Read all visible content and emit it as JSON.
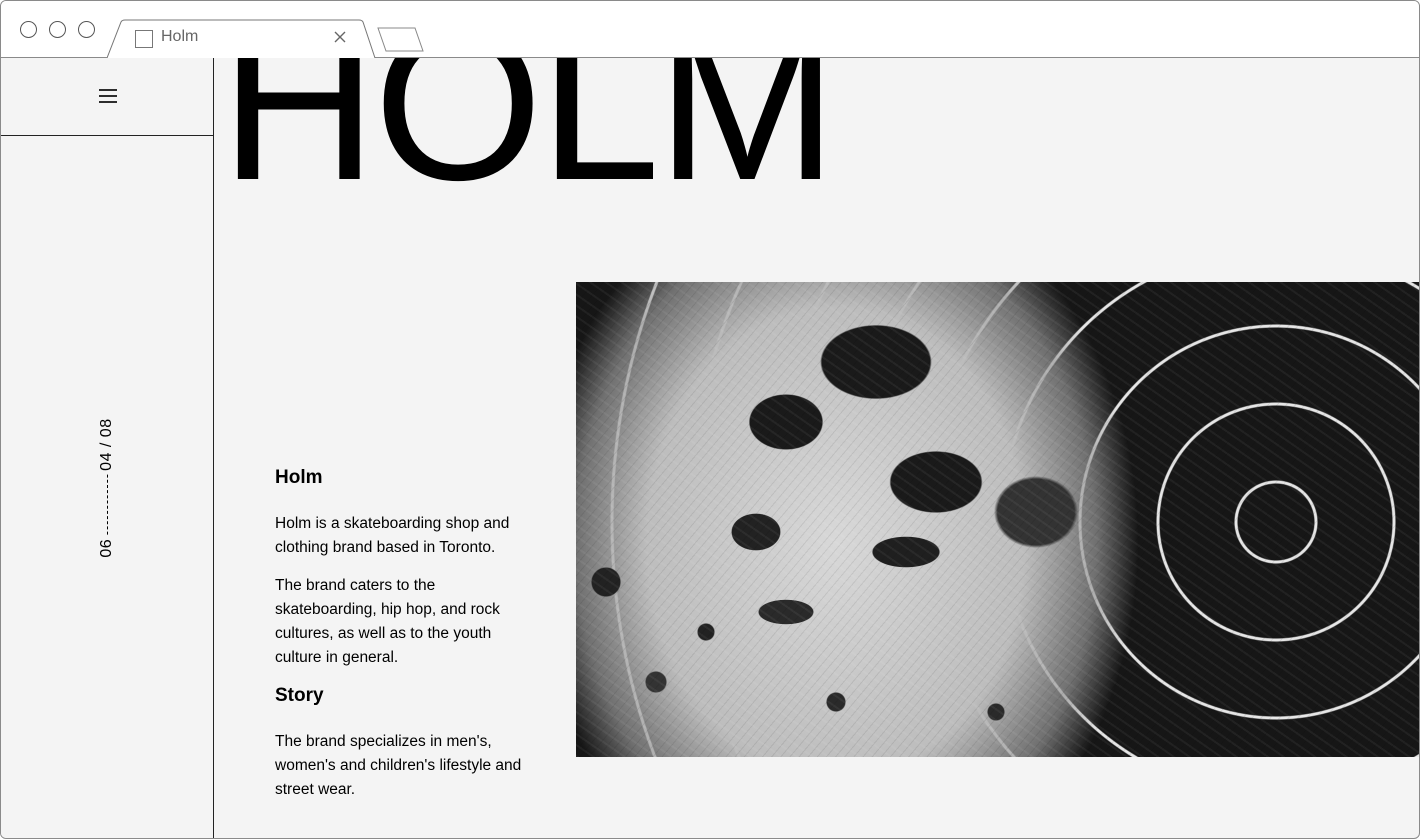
{
  "browser": {
    "tab_title": "Holm",
    "tab_favicon": "blank-page-icon",
    "close_icon": "close-icon",
    "new_tab_icon": "new-tab-icon"
  },
  "sidebar": {
    "menu_icon": "hamburger-menu-icon",
    "counter_current": "04 / 08",
    "counter_total": "06"
  },
  "hero": {
    "title": "HOLM"
  },
  "content": {
    "heading_1": "Holm",
    "paragraph_1": "Holm is a skateboarding shop and clothing brand based in Toronto.",
    "paragraph_2": "The brand caters to the skateboarding, hip hop, and rock cultures, as well as to the youth culture in general.",
    "heading_2": "Story",
    "paragraph_3": "The brand specializes in men's, women's and children's lifestyle and street wear."
  },
  "image": {
    "description": "black-and-white-abstract-texture"
  },
  "colors": {
    "background": "#f4f4f4",
    "text": "#000000",
    "border": "#222222"
  }
}
